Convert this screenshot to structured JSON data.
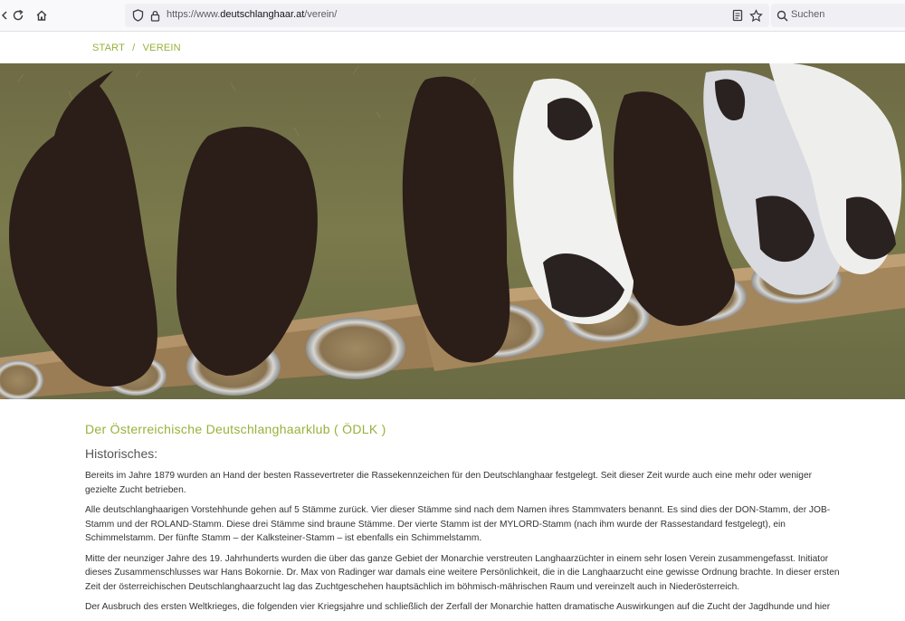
{
  "browser": {
    "url_prefix": "https://www.",
    "url_domain": "deutschlanghaar.at",
    "url_path": "/verein/",
    "search_placeholder": "Suchen"
  },
  "breadcrumb": {
    "home": "START",
    "separator": "/",
    "current": "VEREIN"
  },
  "hero": {
    "alt": "Puppies eating from bowls"
  },
  "article": {
    "title": "Der Österreichische Deutschlanghaarklub ( ÖDLK )",
    "subtitle": "Historisches:",
    "paragraphs": [
      "Bereits im Jahre 1879 wurden an Hand der besten Rassevertreter die Rassekennzeichen für den Deutschlanghaar festgelegt. Seit dieser Zeit wurde auch eine mehr oder weniger gezielte Zucht betrieben.",
      "Alle deutschlanghaarigen Vorstehhunde gehen auf 5 Stämme zurück. Vier dieser Stämme sind nach dem Namen ihres Stammvaters benannt. Es sind dies der DON-Stamm, der JOB-Stamm und der ROLAND-Stamm. Diese drei Stämme sind braune Stämme. Der vierte Stamm ist der MYLORD-Stamm (nach ihm wurde der Rassestandard festgelegt), ein Schimmelstamm. Der fünfte Stamm – der Kalksteiner-Stamm  – ist ebenfalls ein Schimmelstamm.",
      "Mitte der neunziger Jahre des 19. Jahrhunderts wurden die über das ganze Gebiet der Monarchie verstreuten Langhaarzüchter in einem sehr losen Verein zusammengefasst. Initiator dieses Zusammenschlusses war Hans Bokornie. Dr. Max von Radinger war damals eine weitere Persönlichkeit, die in die Langhaarzucht eine gewisse Ordnung brachte. In dieser ersten Zeit der österreichischen Deutschlanghaarzucht lag das Zuchtgeschehen hauptsächlich im böhmisch-mährischen Raum und vereinzelt auch in Niederösterreich.",
      "Der Ausbruch des ersten Weltkrieges, die folgenden vier Kriegsjahre und schließlich der Zerfall der Monarchie hatten dramatische Auswirkungen auf die Zucht der Jagdhunde und hier"
    ]
  }
}
